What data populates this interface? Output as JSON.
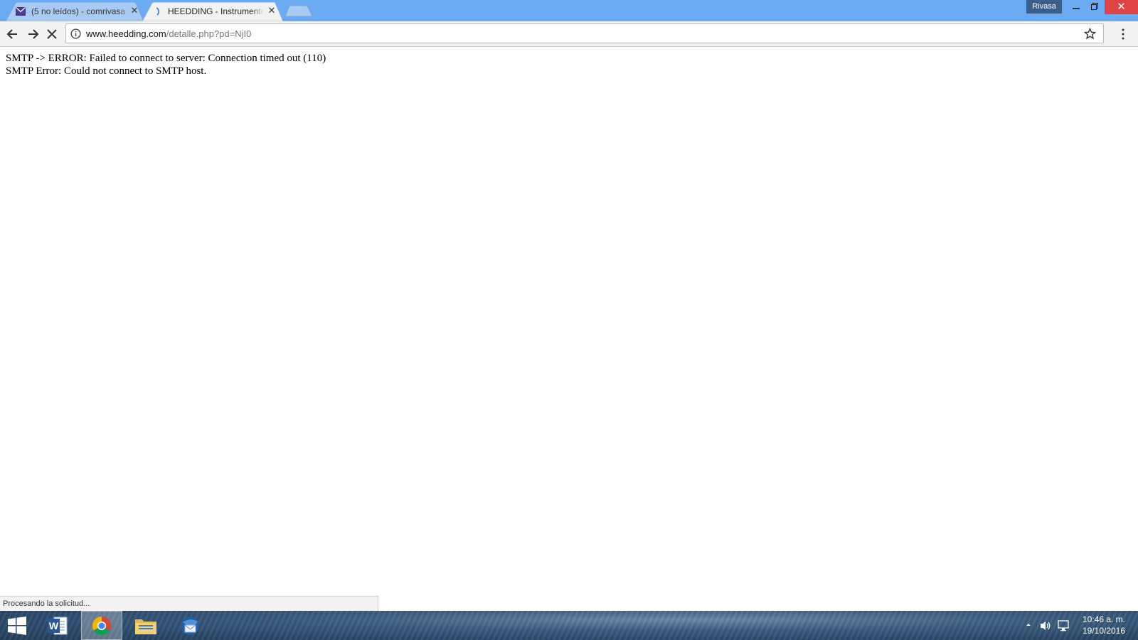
{
  "browser": {
    "tabs": [
      {
        "title": "(5 no leídos) - comrivasa",
        "favicon": "mail-icon",
        "active": false
      },
      {
        "title": "HEEDDING - Instrumentos",
        "favicon": "loading-spinner-icon",
        "active": true
      }
    ],
    "profile_label": "Rivasa",
    "url_host": "www.heedding.com",
    "url_path": "/detalle.php?pd=NjI0"
  },
  "page": {
    "line1": "SMTP -> ERROR: Failed to connect to server: Connection timed out (110)",
    "line2": "SMTP Error: Could not connect to SMTP host."
  },
  "status_bar": {
    "text": "Procesando la solicitud..."
  },
  "taskbar": {
    "apps": [
      "start-icon",
      "word-icon",
      "chrome-icon",
      "file-explorer-icon",
      "thunderbird-icon"
    ],
    "clock_time": "10:46 a. m.",
    "clock_date": "19/10/2016"
  },
  "colors": {
    "titlebar": "#6aabf3",
    "close_button": "#e04343",
    "profile_badge": "#3b5f8a"
  }
}
